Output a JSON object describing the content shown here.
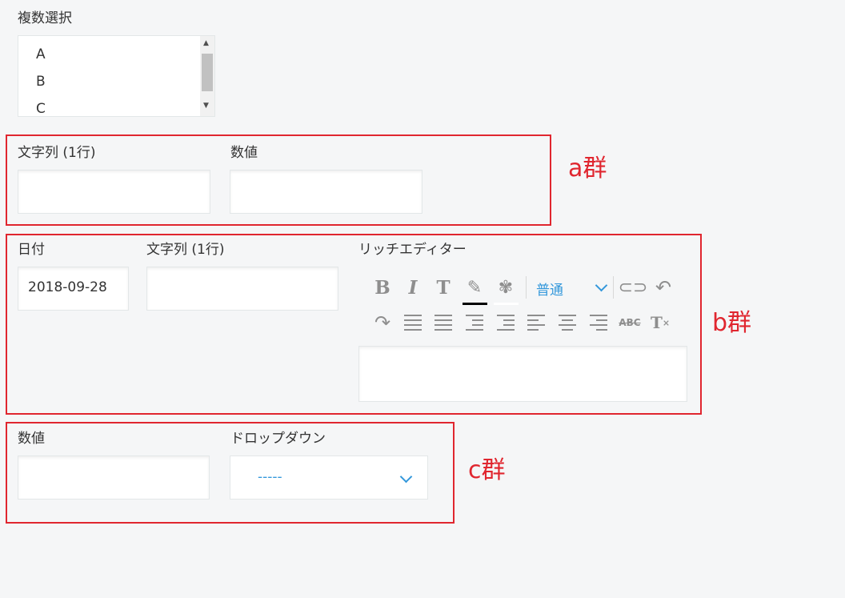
{
  "multi_select": {
    "label": "複数選択",
    "options": [
      "A",
      "B",
      "C"
    ]
  },
  "group_a": {
    "tag": "a群",
    "text_label": "文字列 (1行)",
    "number_label": "数値"
  },
  "group_b": {
    "tag": "b群",
    "date_label": "日付",
    "date_value": "2018-09-28",
    "text_label": "文字列 (1行)",
    "rich_label": "リッチエディター",
    "format_select": "普通"
  },
  "group_c": {
    "tag": "c群",
    "number_label": "数値",
    "dropdown_label": "ドロップダウン",
    "dropdown_value": "-----"
  },
  "colors": {
    "group_border": "#e0262f",
    "accent": "#3498db"
  }
}
